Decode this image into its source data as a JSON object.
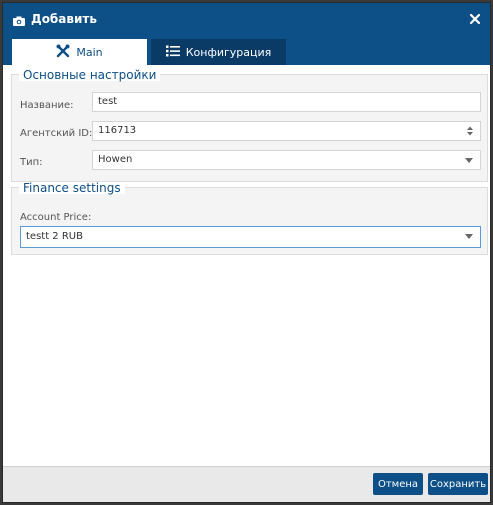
{
  "dialog": {
    "title": "Добавить",
    "title_icon": "camera-icon",
    "close_icon": "close-icon"
  },
  "tabs": [
    {
      "label": "Main",
      "icon": "tools-icon",
      "active": true
    },
    {
      "label": "Конфигурация",
      "icon": "list-icon",
      "active": false
    }
  ],
  "main_settings": {
    "legend": "Основные настройки",
    "name": {
      "label": "Название:",
      "value": "test"
    },
    "agent_id": {
      "label": "Агентский ID:",
      "value": "116713"
    },
    "type": {
      "label": "Тип:",
      "value": "Howen"
    }
  },
  "finance": {
    "legend": "Finance settings",
    "account_price": {
      "label": "Account Price:",
      "value": "testt 2 RUB"
    }
  },
  "footer": {
    "cancel_label": "Отмена",
    "save_label": "Сохранить"
  },
  "colors": {
    "primary": "#0d4f87",
    "tab_inactive": "#0a3a66",
    "focus_border": "#5b9bd5"
  }
}
